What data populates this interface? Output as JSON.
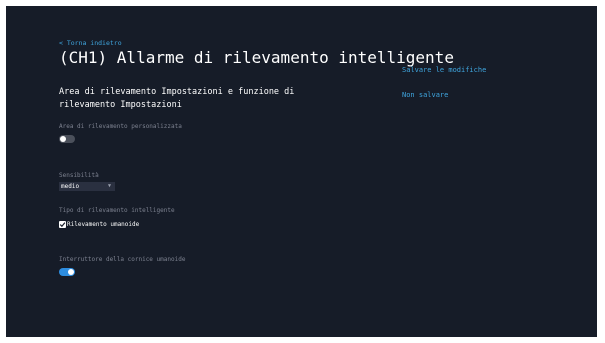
{
  "header": {
    "back_label": "< Torna indietro",
    "title": "(CH1) Allarme di rilevamento intelligente"
  },
  "actions": {
    "save_label": "Salvare le modifiche",
    "discard_label": "Non salvare"
  },
  "section": {
    "heading": "Area di rilevamento Impostazioni e funzione di rilevamento Impostazioni"
  },
  "custom_area": {
    "label": "Area di rilevamento personalizzata",
    "enabled": false
  },
  "sensitivity": {
    "label": "Sensibilità",
    "selected": "medio"
  },
  "detection_type": {
    "label": "Tipo di rilevamento intelligente",
    "options": [
      {
        "label": "Rilevamento umanoide",
        "checked": true
      }
    ]
  },
  "humanoid_frame": {
    "label": "Interruttore della cornice umanoide",
    "enabled": true
  },
  "colors": {
    "background": "#161c28",
    "accent": "#3fa6df",
    "toggle_on": "#2d8de0"
  }
}
